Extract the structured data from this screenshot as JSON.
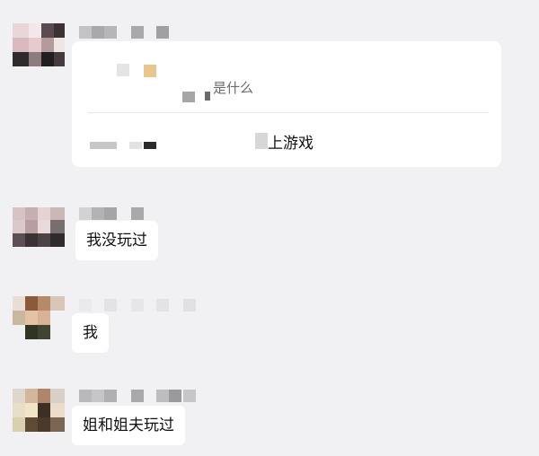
{
  "chat": {
    "quote_card": {
      "question": "是什么",
      "answer": "上游戏"
    },
    "messages": [
      {
        "text": "我没玩过"
      },
      {
        "text": "我"
      },
      {
        "text": "姐和姐夫玩过"
      }
    ]
  },
  "colors": {
    "background": "#f1f1f3",
    "bubble": "#ffffff",
    "text": "#111111",
    "quote_text": "#6b6b6b"
  }
}
